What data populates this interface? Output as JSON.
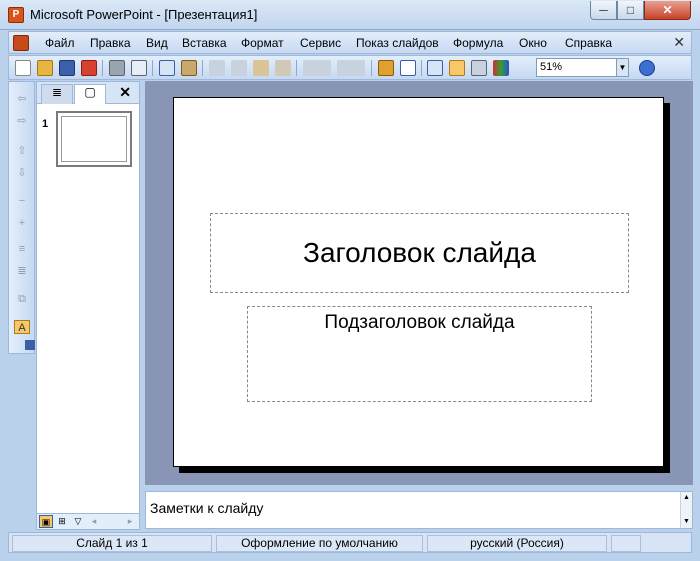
{
  "window": {
    "title": "Microsoft PowerPoint - [Презентация1]",
    "app_icon": "powerpoint-icon",
    "buttons": {
      "minimize": "─",
      "maximize": "□",
      "close": "✕"
    }
  },
  "menu": {
    "items": [
      "Файл",
      "Правка",
      "Вид",
      "Вставка",
      "Формат",
      "Сервис",
      "Показ слайдов",
      "Формула",
      "Окно",
      "Справка"
    ],
    "close_glyph": "✕"
  },
  "toolbar": {
    "zoom_value": "51%",
    "zoom_arrow": "▼"
  },
  "slides_pane": {
    "tab_outline_glyph": "≣",
    "tab_slides_glyph": "▢",
    "close_glyph": "✕",
    "thumbnail_number": "1",
    "view_buttons": [
      "▣",
      "⊞",
      "▽"
    ],
    "scroll_left": "◂",
    "scroll_right": "▸"
  },
  "slide": {
    "title_placeholder": "Заголовок слайда",
    "subtitle_placeholder": "Подзаголовок слайда"
  },
  "notes": {
    "placeholder": "Заметки к слайду",
    "scroll_up": "▲",
    "scroll_down": "▼"
  },
  "statusbar": {
    "slide_position": "Слайд 1 из 1",
    "design": "Оформление по умолчанию",
    "language": "русский (Россия)"
  },
  "colors": {
    "accent": "#c84a1b",
    "workspace": "#8995b4",
    "chrome": "#c6d9f2"
  }
}
